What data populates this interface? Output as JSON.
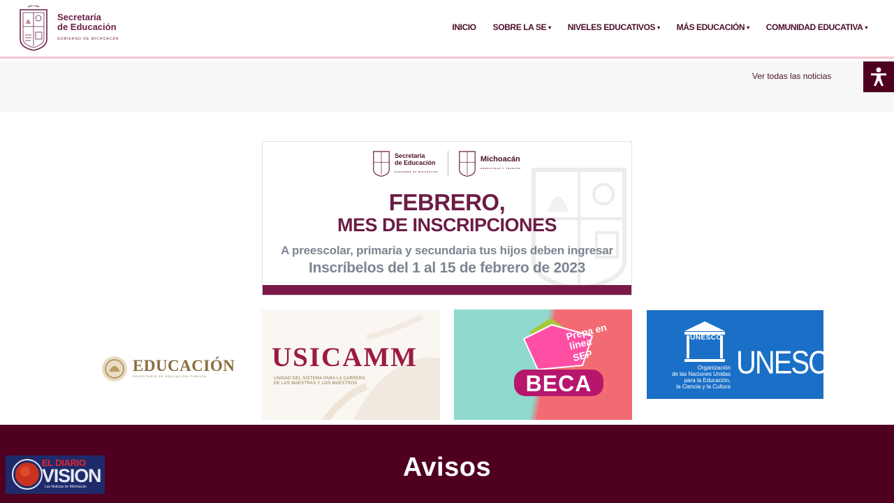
{
  "header": {
    "brand_line1": "Secretaría",
    "brand_line2": "de Educación",
    "brand_sub": "GOBIERNO DE MICHOACÁN"
  },
  "nav": {
    "items": [
      {
        "label": "INICIO",
        "dropdown": false
      },
      {
        "label": "SOBRE LA SE",
        "dropdown": true
      },
      {
        "label": "NIVELES EDUCATIVOS",
        "dropdown": true
      },
      {
        "label": "MÁS EDUCACIÓN",
        "dropdown": true
      },
      {
        "label": "COMUNIDAD EDUCATIVA",
        "dropdown": true
      }
    ],
    "caret_glyph": "▾"
  },
  "news": {
    "all_news_link": "Ver todas las noticias"
  },
  "accessibility": {
    "icon": "accessibility-icon"
  },
  "banner": {
    "logo1_line1": "Secretaría",
    "logo1_line2": "de Educación",
    "logo1_sub": "GOBIERNO DE MICHOACÁN",
    "logo2_name": "Michoacán",
    "logo2_sub": "HONESTIDAD Y TRABAJO",
    "title1": "FEBRERO,",
    "title2": "MES DE INSCRIPCIONES",
    "subtitle": "A preescolar, primaria y secundaria tus hijos deben ingresar",
    "dates": "Inscríbelos del 1 al 15 de febrero de 2023"
  },
  "partners": {
    "educacion": {
      "title": "EDUCACIÓN",
      "sub": "SECRETARÍA DE EDUCACIÓN PÚBLICA"
    },
    "usicamm": {
      "title": "USICAMM",
      "sub1": "UNIDAD DEL SISTEMA PARA LA CARRERA",
      "sub2": "DE LAS MAESTRAS Y LOS MAESTROS"
    },
    "beca": {
      "line1": "Prepa en",
      "line2": "línea",
      "line3": "SEP",
      "badge": "BECA"
    },
    "unesco": {
      "emblem_text": "UNESCO",
      "org1": "Organización",
      "org2": "de las Naciones Unidas",
      "org3": "para la Educación,",
      "org4": "la Ciencia y la Cultura",
      "name": "UNESCO"
    }
  },
  "footer": {
    "title": "Avisos"
  },
  "watermark": {
    "line1": "EL DIARIO",
    "line2": "VISION",
    "line3": "Las Noticias de Michoacán"
  },
  "colors": {
    "brand": "#6b1d45",
    "footer": "#4f0020",
    "header_border": "#f4c6cf",
    "banner_bar": "#7a1a49",
    "unesco_blue": "#1a6fc6"
  }
}
